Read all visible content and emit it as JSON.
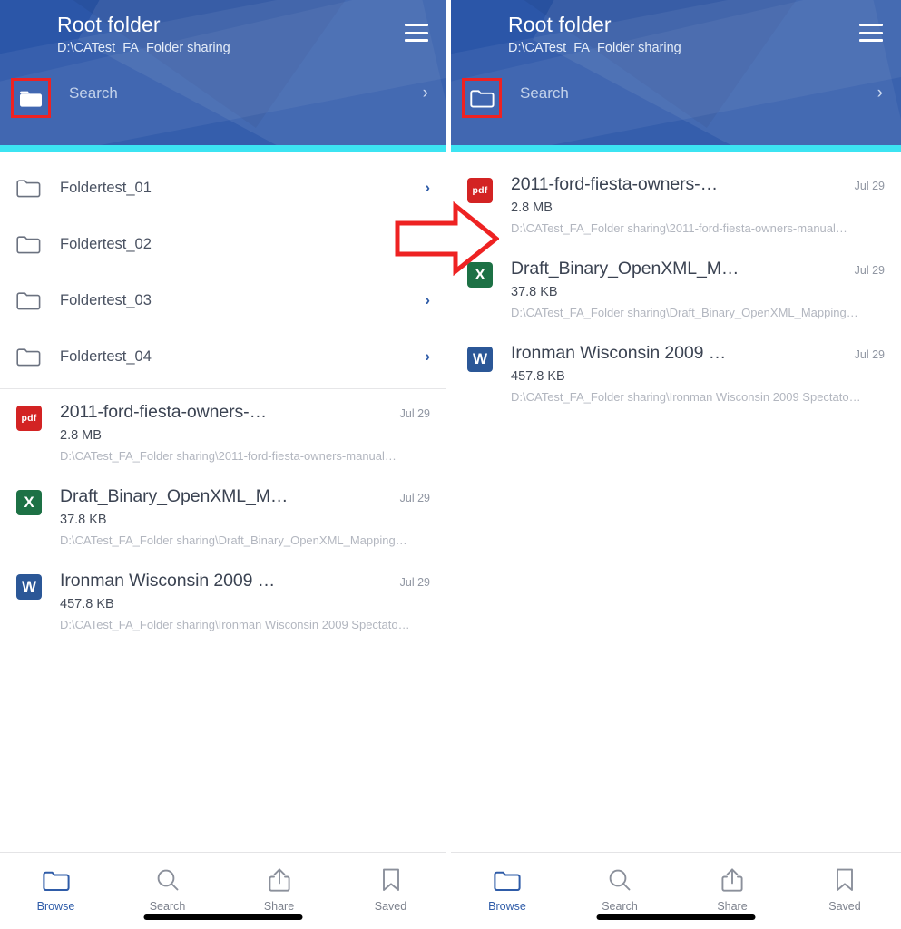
{
  "panels": [
    {
      "id": "left",
      "header": {
        "title": "Root folder",
        "subtitle": "D:\\CATest_FA_Folder sharing",
        "menu_icon": "hamburger-menu-icon",
        "folder_button_icon": "folder-filled-icon",
        "search_placeholder": "Search",
        "search_value": "",
        "search_chevron": "›"
      },
      "folders": [
        {
          "name": "Foldertest_01",
          "chevron": "›"
        },
        {
          "name": "Foldertest_02",
          "chevron": "›"
        },
        {
          "name": "Foldertest_03",
          "chevron": "›"
        },
        {
          "name": "Foldertest_04",
          "chevron": "›"
        }
      ],
      "files": [
        {
          "type": "pdf",
          "badge": "pdf",
          "name": "2011-ford-fiesta-owners-…",
          "date": "Jul 29",
          "size": "2.8 MB",
          "path": "D:\\CATest_FA_Folder sharing\\2011-ford-fiesta-owners-manual…"
        },
        {
          "type": "xls",
          "badge": "X",
          "name": "Draft_Binary_OpenXML_M…",
          "date": "Jul 29",
          "size": "37.8 KB",
          "path": "D:\\CATest_FA_Folder sharing\\Draft_Binary_OpenXML_Mapping…"
        },
        {
          "type": "doc",
          "badge": "W",
          "name": "Ironman Wisconsin 2009 …",
          "date": "Jul 29",
          "size": "457.8 KB",
          "path": "D:\\CATest_FA_Folder sharing\\Ironman Wisconsin 2009 Spectato…"
        }
      ],
      "tabs": [
        {
          "label": "Browse",
          "icon": "folder-outline-icon",
          "active": true
        },
        {
          "label": "Search",
          "icon": "magnifier-icon",
          "active": false
        },
        {
          "label": "Share",
          "icon": "share-upload-icon",
          "active": false
        },
        {
          "label": "Saved",
          "icon": "bookmark-icon",
          "active": false
        }
      ]
    },
    {
      "id": "right",
      "header": {
        "title": "Root folder",
        "subtitle": "D:\\CATest_FA_Folder sharing",
        "menu_icon": "hamburger-menu-icon",
        "folder_button_icon": "folder-outline-icon",
        "search_placeholder": "Search",
        "search_value": "",
        "search_chevron": "›"
      },
      "folders": [],
      "files": [
        {
          "type": "pdf",
          "badge": "pdf",
          "name": "2011-ford-fiesta-owners-…",
          "date": "Jul 29",
          "size": "2.8 MB",
          "path": "D:\\CATest_FA_Folder sharing\\2011-ford-fiesta-owners-manual…"
        },
        {
          "type": "xls",
          "badge": "X",
          "name": "Draft_Binary_OpenXML_M…",
          "date": "Jul 29",
          "size": "37.8 KB",
          "path": "D:\\CATest_FA_Folder sharing\\Draft_Binary_OpenXML_Mapping…"
        },
        {
          "type": "doc",
          "badge": "W",
          "name": "Ironman Wisconsin 2009 …",
          "date": "Jul 29",
          "size": "457.8 KB",
          "path": "D:\\CATest_FA_Folder sharing\\Ironman Wisconsin 2009 Spectato…"
        }
      ],
      "tabs": [
        {
          "label": "Browse",
          "icon": "folder-outline-icon",
          "active": true
        },
        {
          "label": "Search",
          "icon": "magnifier-icon",
          "active": false
        },
        {
          "label": "Share",
          "icon": "share-upload-icon",
          "active": false
        },
        {
          "label": "Saved",
          "icon": "bookmark-icon",
          "active": false
        }
      ]
    }
  ],
  "annotations": {
    "highlight_color": "#ee2222",
    "arrow_icon": "right-arrow-annotation",
    "highlight_boxes": [
      "left-folder-button",
      "right-folder-button"
    ]
  },
  "colors": {
    "header_blue": "#2b56a8",
    "accent_cyan": "#3ce4f2",
    "tab_active": "#2f5ca8",
    "pdf_red": "#d32323",
    "excel_green": "#1d7145",
    "word_blue": "#2b5797"
  }
}
